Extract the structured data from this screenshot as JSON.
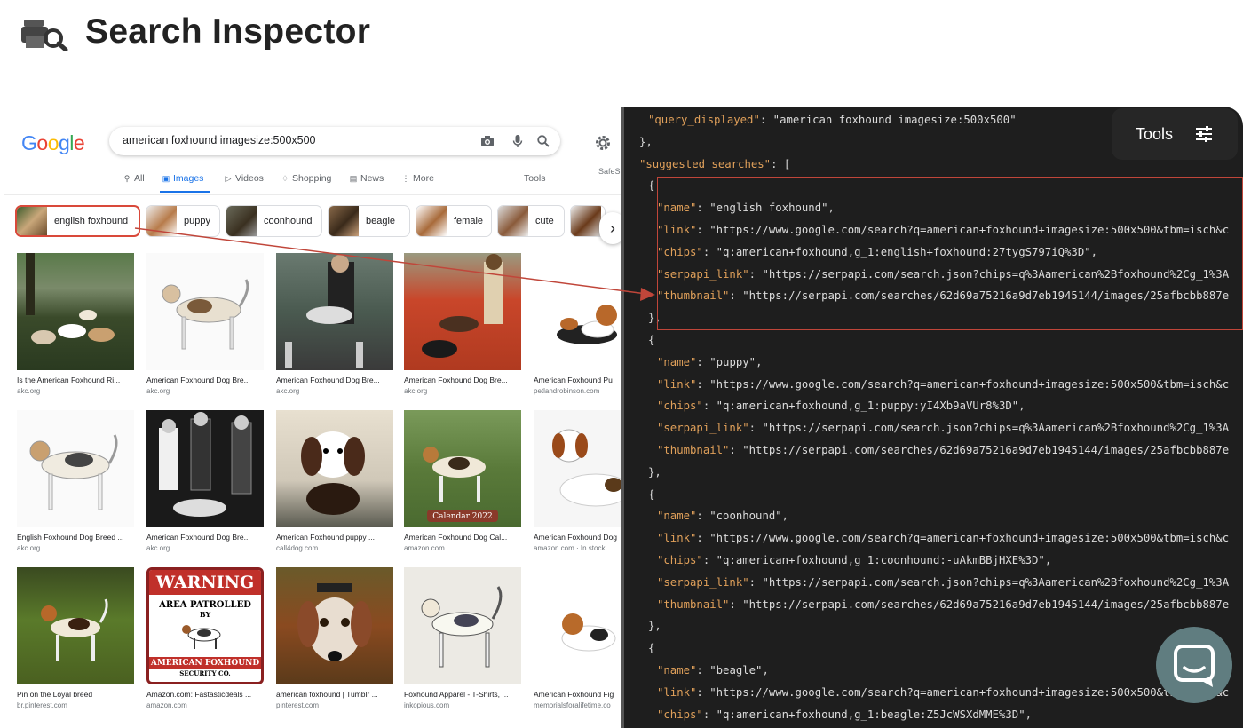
{
  "app": {
    "title": "Search Inspector",
    "logo_icon": "printer-search-icon"
  },
  "google": {
    "logo": [
      "G",
      "o",
      "o",
      "g",
      "l",
      "e"
    ],
    "logo_colors": [
      "#4285f4",
      "#ea4335",
      "#fbbc05",
      "#4285f4",
      "#34a853",
      "#ea4335"
    ],
    "query": "american foxhound imagesize:500x500",
    "safesearch": "SafeS",
    "tabs": {
      "all": "All",
      "images": "Images",
      "videos": "Videos",
      "shopping": "Shopping",
      "news": "News",
      "more": "More",
      "tools": "Tools"
    },
    "chips": [
      "english foxhound",
      "puppy",
      "coonhound",
      "beagle",
      "female",
      "cute"
    ],
    "results": [
      {
        "caption": "Is the American Foxhound Ri...",
        "source": "akc.org"
      },
      {
        "caption": "American Foxhound Dog Bre...",
        "source": "akc.org"
      },
      {
        "caption": "American Foxhound Dog Bre...",
        "source": "akc.org"
      },
      {
        "caption": "American Foxhound Dog Bre...",
        "source": "akc.org"
      },
      {
        "caption": "American Foxhound Pu",
        "source": "petlandrobinson.com"
      },
      {
        "caption": "English Foxhound Dog Breed ...",
        "source": "akc.org"
      },
      {
        "caption": "American Foxhound Dog Bre...",
        "source": "akc.org"
      },
      {
        "caption": "American Foxhound puppy ...",
        "source": "call4dog.com"
      },
      {
        "caption": "American Foxhound Dog Cal...",
        "source": "amazon.com"
      },
      {
        "caption": "American Foxhound Dog",
        "source": "amazon.com · In stock"
      },
      {
        "caption": "Pin on the Loyal breed",
        "source": "br.pinterest.com"
      },
      {
        "caption": "Amazon.com: Fastasticdeals ...",
        "source": "amazon.com"
      },
      {
        "caption": "american foxhound | Tumblr ...",
        "source": "pinterest.com"
      },
      {
        "caption": "Foxhound Apparel - T-Shirts, ...",
        "source": "inkopious.com"
      },
      {
        "caption": "American Foxhound Fig",
        "source": "memorialsforalifetime.co"
      }
    ],
    "images": {
      "calendar_text": "Calendar 2022",
      "warning_title": "WARNING",
      "warning_sub1": "AREA PATROLLED",
      "warning_sub2": "BY",
      "warning_bottom": "AMERICAN FOXHOUND",
      "warning_bottom2": "SECURITY CO."
    }
  },
  "tools_button": {
    "label": "Tools"
  },
  "code_lines": [
    {
      "indent": 3,
      "parts": [
        [
          "k",
          "\"query_displayed\""
        ],
        [
          "p",
          ": "
        ],
        [
          "s",
          "\"american foxhound imagesize:500x500\""
        ]
      ]
    },
    {
      "indent": 2,
      "parts": [
        [
          "p",
          "},"
        ]
      ]
    },
    {
      "indent": 2,
      "parts": [
        [
          "k",
          "\"suggested_searches\""
        ],
        [
          "p",
          ": ["
        ]
      ]
    },
    {
      "indent": 3,
      "parts": [
        [
          "p",
          "{"
        ]
      ]
    },
    {
      "indent": 4,
      "parts": [
        [
          "k",
          "\"name\""
        ],
        [
          "p",
          ": "
        ],
        [
          "s",
          "\"english foxhound\""
        ],
        [
          "p",
          ","
        ]
      ]
    },
    {
      "indent": 4,
      "parts": [
        [
          "k",
          "\"link\""
        ],
        [
          "p",
          ": "
        ],
        [
          "s",
          "\"https://www.google.com/search?q=american+foxhound+imagesize:500x500&tbm=isch&c"
        ]
      ]
    },
    {
      "indent": 4,
      "parts": [
        [
          "k",
          "\"chips\""
        ],
        [
          "p",
          ": "
        ],
        [
          "s",
          "\"q:american+foxhound,g_1:english+foxhound:27tygS797iQ%3D\""
        ],
        [
          "p",
          ","
        ]
      ]
    },
    {
      "indent": 4,
      "parts": [
        [
          "k",
          "\"serpapi_link\""
        ],
        [
          "p",
          ": "
        ],
        [
          "s",
          "\"https://serpapi.com/search.json?chips=q%3Aamerican%2Bfoxhound%2Cg_1%3A"
        ]
      ]
    },
    {
      "indent": 4,
      "parts": [
        [
          "k",
          "\"thumbnail\""
        ],
        [
          "p",
          ": "
        ],
        [
          "s",
          "\"https://serpapi.com/searches/62d69a75216a9d7eb1945144/images/25afbcbb887e"
        ]
      ]
    },
    {
      "indent": 3,
      "parts": [
        [
          "p",
          "},"
        ]
      ]
    },
    {
      "indent": 3,
      "parts": [
        [
          "p",
          "{"
        ]
      ]
    },
    {
      "indent": 4,
      "parts": [
        [
          "k",
          "\"name\""
        ],
        [
          "p",
          ": "
        ],
        [
          "s",
          "\"puppy\""
        ],
        [
          "p",
          ","
        ]
      ]
    },
    {
      "indent": 4,
      "parts": [
        [
          "k",
          "\"link\""
        ],
        [
          "p",
          ": "
        ],
        [
          "s",
          "\"https://www.google.com/search?q=american+foxhound+imagesize:500x500&tbm=isch&c"
        ]
      ]
    },
    {
      "indent": 4,
      "parts": [
        [
          "k",
          "\"chips\""
        ],
        [
          "p",
          ": "
        ],
        [
          "s",
          "\"q:american+foxhound,g_1:puppy:yI4Xb9aVUr8%3D\""
        ],
        [
          "p",
          ","
        ]
      ]
    },
    {
      "indent": 4,
      "parts": [
        [
          "k",
          "\"serpapi_link\""
        ],
        [
          "p",
          ": "
        ],
        [
          "s",
          "\"https://serpapi.com/search.json?chips=q%3Aamerican%2Bfoxhound%2Cg_1%3A"
        ]
      ]
    },
    {
      "indent": 4,
      "parts": [
        [
          "k",
          "\"thumbnail\""
        ],
        [
          "p",
          ": "
        ],
        [
          "s",
          "\"https://serpapi.com/searches/62d69a75216a9d7eb1945144/images/25afbcbb887e"
        ]
      ]
    },
    {
      "indent": 3,
      "parts": [
        [
          "p",
          "},"
        ]
      ]
    },
    {
      "indent": 3,
      "parts": [
        [
          "p",
          "{"
        ]
      ]
    },
    {
      "indent": 4,
      "parts": [
        [
          "k",
          "\"name\""
        ],
        [
          "p",
          ": "
        ],
        [
          "s",
          "\"coonhound\""
        ],
        [
          "p",
          ","
        ]
      ]
    },
    {
      "indent": 4,
      "parts": [
        [
          "k",
          "\"link\""
        ],
        [
          "p",
          ": "
        ],
        [
          "s",
          "\"https://www.google.com/search?q=american+foxhound+imagesize:500x500&tbm=isch&c"
        ]
      ]
    },
    {
      "indent": 4,
      "parts": [
        [
          "k",
          "\"chips\""
        ],
        [
          "p",
          ": "
        ],
        [
          "s",
          "\"q:american+foxhound,g_1:coonhound:-uAkmBBjHXE%3D\""
        ],
        [
          "p",
          ","
        ]
      ]
    },
    {
      "indent": 4,
      "parts": [
        [
          "k",
          "\"serpapi_link\""
        ],
        [
          "p",
          ": "
        ],
        [
          "s",
          "\"https://serpapi.com/search.json?chips=q%3Aamerican%2Bfoxhound%2Cg_1%3A"
        ]
      ]
    },
    {
      "indent": 4,
      "parts": [
        [
          "k",
          "\"thumbnail\""
        ],
        [
          "p",
          ": "
        ],
        [
          "s",
          "\"https://serpapi.com/searches/62d69a75216a9d7eb1945144/images/25afbcbb887e"
        ]
      ]
    },
    {
      "indent": 3,
      "parts": [
        [
          "p",
          "},"
        ]
      ]
    },
    {
      "indent": 3,
      "parts": [
        [
          "p",
          "{"
        ]
      ]
    },
    {
      "indent": 4,
      "parts": [
        [
          "k",
          "\"name\""
        ],
        [
          "p",
          ": "
        ],
        [
          "s",
          "\"beagle\""
        ],
        [
          "p",
          ","
        ]
      ]
    },
    {
      "indent": 4,
      "parts": [
        [
          "k",
          "\"link\""
        ],
        [
          "p",
          ": "
        ],
        [
          "s",
          "\"https://www.google.com/search?q=american+foxhound+imagesize:500x500&tbm=isch&c"
        ]
      ]
    },
    {
      "indent": 4,
      "parts": [
        [
          "k",
          "\"chips\""
        ],
        [
          "p",
          ": "
        ],
        [
          "s",
          "\"q:american+foxhound,g_1:beagle:Z5JcWSXdMME%3D\""
        ],
        [
          "p",
          ","
        ]
      ]
    }
  ],
  "colors": {
    "code_bg": "#1e1e1e",
    "key": "#e0a05a",
    "highlight": "#c0463a",
    "chat": "#607d80"
  }
}
